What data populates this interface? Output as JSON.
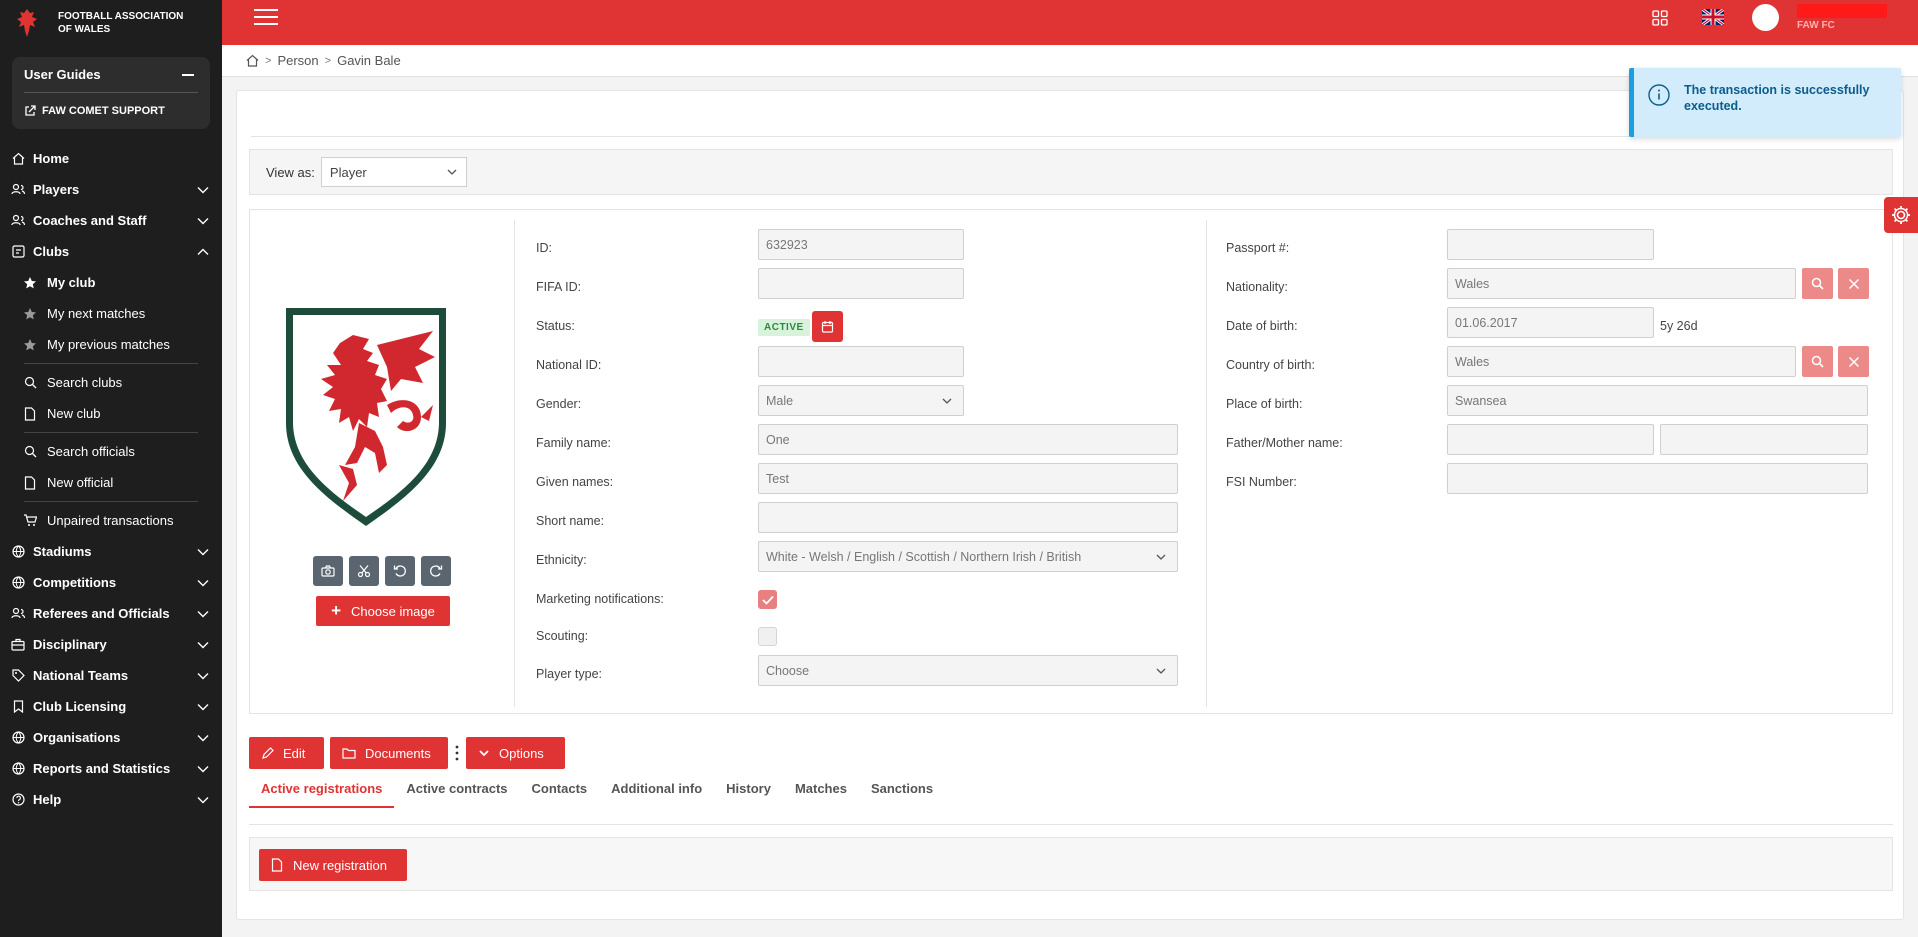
{
  "brand": {
    "name": "FOOTBALL ASSOCIATION OF WALES"
  },
  "user_guides": {
    "title": "User Guides",
    "support_link": "FAW COMET SUPPORT"
  },
  "sidebar": {
    "home": "Home",
    "players": "Players",
    "coaches": "Coaches and Staff",
    "clubs": "Clubs",
    "clubs_sub": {
      "my_club": "My club",
      "next_matches": "My next matches",
      "previous_matches": "My previous matches",
      "search_clubs": "Search clubs",
      "new_club": "New club",
      "search_officials": "Search officials",
      "new_official": "New official",
      "unpaired": "Unpaired transactions"
    },
    "stadiums": "Stadiums",
    "competitions": "Competitions",
    "referees": "Referees and Officials",
    "disciplinary": "Disciplinary",
    "national_teams": "National Teams",
    "club_licensing": "Club Licensing",
    "organisations": "Organisations",
    "reports": "Reports and Statistics",
    "help": "Help"
  },
  "topbar": {
    "club": "FAW FC"
  },
  "breadcrumb": {
    "item1": "Person",
    "item2": "Gavin Bale"
  },
  "view_as": {
    "label": "View as:",
    "value": "Player"
  },
  "toast": {
    "message": "The transaction is successfully executed."
  },
  "form_left": {
    "id_label": "ID:",
    "id_value": "632923",
    "fifa_label": "FIFA ID:",
    "fifa_value": "",
    "status_label": "Status:",
    "status_value": "ACTIVE",
    "national_label": "National ID:",
    "national_value": "",
    "gender_label": "Gender:",
    "gender_value": "Male",
    "family_label": "Family name:",
    "family_value": "One",
    "given_label": "Given names:",
    "given_value": "Test",
    "short_label": "Short name:",
    "short_value": "",
    "ethnicity_label": "Ethnicity:",
    "ethnicity_value": "White - Welsh / English / Scottish / Northern Irish / British",
    "marketing_label": "Marketing notifications:",
    "marketing_checked": true,
    "scouting_label": "Scouting:",
    "scouting_checked": false,
    "player_type_label": "Player type:",
    "player_type_value": "Choose"
  },
  "form_right": {
    "passport_label": "Passport #:",
    "passport_value": "",
    "nationality_label": "Nationality:",
    "nationality_value": "Wales",
    "dob_label": "Date of birth:",
    "dob_value": "01.06.2017",
    "age": "5y 26d",
    "cob_label": "Country of birth:",
    "cob_value": "Wales",
    "pob_label": "Place of birth:",
    "pob_value": "Swansea",
    "parent_label": "Father/Mother name:",
    "father_value": "",
    "mother_value": "",
    "fsi_label": "FSI Number:",
    "fsi_value": ""
  },
  "image": {
    "choose_label": "Choose image"
  },
  "actions": {
    "edit": "Edit",
    "documents": "Documents",
    "options": "Options"
  },
  "tabs": [
    "Active registrations",
    "Active contracts",
    "Contacts",
    "Additional info",
    "History",
    "Matches",
    "Sanctions"
  ],
  "registration": {
    "new_label": "New registration"
  },
  "colors": {
    "brand_red": "#e03434",
    "sidebar_bg": "#1e1e1e",
    "crest_green": "#1d4d3a",
    "toast_bg": "#d3ecfb"
  }
}
